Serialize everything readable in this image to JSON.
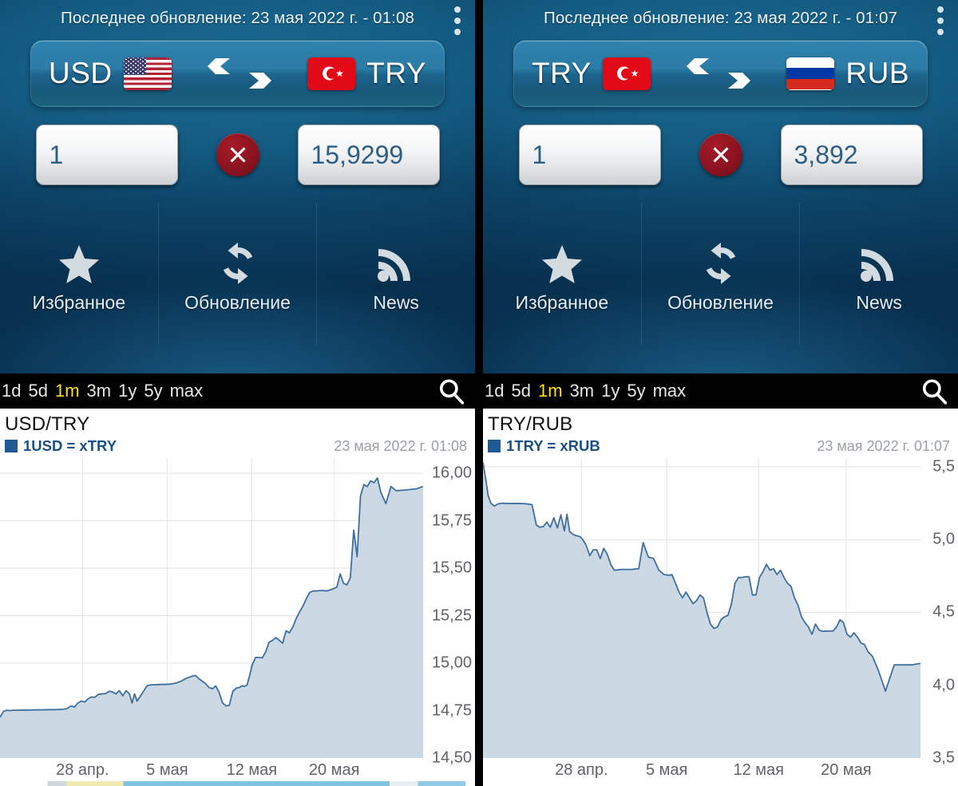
{
  "panels": [
    {
      "id": "usd-try",
      "last_update_label": "Последнее обновление: 23 мая 2022 г. - 01:08",
      "from_code": "USD",
      "from_flag": "flag-us-icon",
      "to_code": "TRY",
      "to_flag": "flag-tr-icon",
      "swap_icon": "swap-arrows-icon",
      "menu_icon": "overflow-menu-icon",
      "amount_value": "1",
      "amount_placeholder": "1",
      "multiply_icon": "clear-x-icon",
      "result_value": "15,9299",
      "actions": [
        {
          "icon": "star-icon",
          "label": "Избранное"
        },
        {
          "icon": "refresh-icon",
          "label": "Обновление"
        },
        {
          "icon": "rss-news-icon",
          "label": "News"
        }
      ],
      "ranges": [
        "1d",
        "5d",
        "1m",
        "3m",
        "1y",
        "5y",
        "max"
      ],
      "range_selected": "1m",
      "search_icon": "search-icon",
      "chart_title": "USD/TRY",
      "chart_legend": "1USD = xTRY",
      "chart_stamp": "23 мая 2022 г. 01:08",
      "legend_color": "#1f5a93"
    },
    {
      "id": "try-rub",
      "last_update_label": "Последнее обновление: 23 мая 2022 г. - 01:07",
      "from_code": "TRY",
      "from_flag": "flag-tr-icon",
      "to_code": "RUB",
      "to_flag": "flag-ru-icon",
      "swap_icon": "swap-arrows-icon",
      "menu_icon": "overflow-menu-icon",
      "amount_value": "1",
      "amount_placeholder": "1",
      "multiply_icon": "clear-x-icon",
      "result_value": "3,892",
      "actions": [
        {
          "icon": "star-icon",
          "label": "Избранное"
        },
        {
          "icon": "refresh-icon",
          "label": "Обновление"
        },
        {
          "icon": "rss-news-icon",
          "label": "News"
        }
      ],
      "ranges": [
        "1d",
        "5d",
        "1m",
        "3m",
        "1y",
        "5y",
        "max"
      ],
      "range_selected": "1m",
      "search_icon": "search-icon",
      "chart_title": "TRY/RUB",
      "chart_legend": "1TRY = xRUB",
      "chart_stamp": "23 мая 2022 г. 01:07",
      "legend_color": "#1f5a93"
    }
  ],
  "chart_data": [
    {
      "type": "area",
      "title": "USD/TRY",
      "legend": [
        "1USD = xTRY"
      ],
      "legend_position": "top-left",
      "xlabel": "",
      "ylabel": "",
      "grid": true,
      "ylim": [
        14.5,
        16.08
      ],
      "yticks": [
        16.0,
        15.75,
        15.5,
        15.25,
        15.0,
        14.75,
        14.5
      ],
      "ytick_labels": [
        "16,00",
        "15,75",
        "15,50",
        "15,25",
        "15,00",
        "14,75",
        "14,50"
      ],
      "xticks": [
        0.195,
        0.395,
        0.595,
        0.79
      ],
      "xtick_labels": [
        "28 апр.",
        "5 мая",
        "12 мая",
        "20 мая"
      ],
      "line_color": "#3f6f9e",
      "fill_color": "#ccd9e5",
      "x": [
        0.0,
        0.008,
        0.016,
        0.024,
        0.032,
        0.042,
        0.055,
        0.07,
        0.085,
        0.1,
        0.115,
        0.13,
        0.145,
        0.158,
        0.168,
        0.176,
        0.184,
        0.192,
        0.2,
        0.208,
        0.216,
        0.224,
        0.232,
        0.24,
        0.25,
        0.258,
        0.266,
        0.274,
        0.282,
        0.29,
        0.298,
        0.306,
        0.312,
        0.318,
        0.324,
        0.33,
        0.338,
        0.348,
        0.358,
        0.368,
        0.38,
        0.392,
        0.404,
        0.416,
        0.428,
        0.44,
        0.452,
        0.462,
        0.47,
        0.478,
        0.486,
        0.494,
        0.502,
        0.51,
        0.518,
        0.526,
        0.534,
        0.542,
        0.55,
        0.558,
        0.566,
        0.572,
        0.578,
        0.584,
        0.59,
        0.596,
        0.604,
        0.612,
        0.62,
        0.628,
        0.636,
        0.644,
        0.652,
        0.66,
        0.668,
        0.676,
        0.684,
        0.692,
        0.7,
        0.708,
        0.716,
        0.724,
        0.732,
        0.74,
        0.748,
        0.756,
        0.764,
        0.772,
        0.78,
        0.788,
        0.796,
        0.804,
        0.812,
        0.82,
        0.828,
        0.836,
        0.844,
        0.852,
        0.86,
        0.868,
        0.876,
        0.884,
        0.892,
        0.9,
        0.912,
        0.924,
        0.936,
        0.948,
        0.96,
        0.972,
        0.984,
        1.0
      ],
      "y": [
        14.715,
        14.745,
        14.752,
        14.75,
        14.752,
        14.752,
        14.753,
        14.753,
        14.754,
        14.754,
        14.755,
        14.755,
        14.756,
        14.76,
        14.775,
        14.768,
        14.79,
        14.8,
        14.795,
        14.812,
        14.822,
        14.82,
        14.835,
        14.838,
        14.84,
        14.852,
        14.848,
        14.838,
        14.855,
        14.828,
        14.855,
        14.838,
        14.79,
        14.838,
        14.8,
        14.82,
        14.848,
        14.882,
        14.886,
        14.886,
        14.888,
        14.888,
        14.89,
        14.895,
        14.905,
        14.92,
        14.93,
        14.935,
        14.918,
        14.905,
        14.892,
        14.872,
        14.865,
        14.88,
        14.845,
        14.79,
        14.775,
        14.778,
        14.85,
        14.868,
        14.872,
        14.88,
        14.878,
        14.885,
        14.935,
        14.99,
        15.03,
        15.03,
        15.028,
        15.06,
        15.11,
        15.12,
        15.135,
        15.12,
        15.105,
        15.17,
        15.16,
        15.19,
        15.235,
        15.27,
        15.3,
        15.34,
        15.372,
        15.38,
        15.38,
        15.382,
        15.382,
        15.38,
        15.385,
        15.392,
        15.4,
        15.47,
        15.42,
        15.412,
        15.45,
        15.7,
        15.56,
        15.88,
        15.94,
        15.93,
        15.96,
        15.95,
        15.975,
        15.9,
        15.84,
        15.93,
        15.908,
        15.91,
        15.912,
        15.915,
        15.918,
        15.93
      ]
    },
    {
      "type": "area",
      "title": "TRY/RUB",
      "legend": [
        "1TRY = xRUB"
      ],
      "legend_position": "top-left",
      "xlabel": "",
      "ylabel": "",
      "grid": true,
      "ylim": [
        3.5,
        5.56
      ],
      "yticks": [
        5.5,
        5.0,
        4.5,
        4.0,
        3.5
      ],
      "ytick_labels": [
        "5,5",
        "5,0",
        "4,5",
        "4,0",
        "3,5"
      ],
      "xticks": [
        0.225,
        0.42,
        0.63,
        0.83
      ],
      "xtick_labels": [
        "28 апр.",
        "5 мая",
        "12 мая",
        "20 мая"
      ],
      "line_color": "#3f6f9e",
      "fill_color": "#ccd9e5",
      "x": [
        0.0,
        0.006,
        0.012,
        0.018,
        0.026,
        0.034,
        0.044,
        0.056,
        0.07,
        0.084,
        0.098,
        0.112,
        0.122,
        0.13,
        0.138,
        0.146,
        0.154,
        0.162,
        0.17,
        0.178,
        0.186,
        0.192,
        0.198,
        0.204,
        0.21,
        0.216,
        0.222,
        0.228,
        0.236,
        0.244,
        0.252,
        0.26,
        0.268,
        0.276,
        0.284,
        0.292,
        0.3,
        0.308,
        0.316,
        0.324,
        0.332,
        0.34,
        0.348,
        0.356,
        0.366,
        0.378,
        0.39,
        0.402,
        0.414,
        0.424,
        0.432,
        0.44,
        0.448,
        0.456,
        0.464,
        0.472,
        0.48,
        0.488,
        0.496,
        0.504,
        0.512,
        0.52,
        0.528,
        0.536,
        0.544,
        0.552,
        0.56,
        0.568,
        0.576,
        0.584,
        0.592,
        0.6,
        0.608,
        0.616,
        0.624,
        0.632,
        0.64,
        0.648,
        0.656,
        0.664,
        0.672,
        0.68,
        0.688,
        0.696,
        0.704,
        0.712,
        0.72,
        0.728,
        0.736,
        0.744,
        0.752,
        0.76,
        0.768,
        0.776,
        0.784,
        0.792,
        0.8,
        0.808,
        0.816,
        0.824,
        0.832,
        0.84,
        0.848,
        0.856,
        0.864,
        0.872,
        0.88,
        0.89,
        0.904,
        0.92,
        0.94,
        0.96,
        0.98,
        1.0
      ],
      "y": [
        5.53,
        5.42,
        5.3,
        5.25,
        5.23,
        5.245,
        5.25,
        5.248,
        5.248,
        5.248,
        5.246,
        5.24,
        5.1,
        5.085,
        5.09,
        5.12,
        5.085,
        5.15,
        5.08,
        5.17,
        5.06,
        5.175,
        5.055,
        5.04,
        5.03,
        5.025,
        5.02,
        5.0,
        4.96,
        4.89,
        4.93,
        4.93,
        4.87,
        4.94,
        4.9,
        4.83,
        4.79,
        4.792,
        4.795,
        4.795,
        4.795,
        4.795,
        4.798,
        4.8,
        4.98,
        4.88,
        4.87,
        4.79,
        4.76,
        4.755,
        4.76,
        4.7,
        4.64,
        4.6,
        4.64,
        4.6,
        4.56,
        4.58,
        4.62,
        4.6,
        4.5,
        4.42,
        4.39,
        4.4,
        4.45,
        4.47,
        4.48,
        4.56,
        4.7,
        4.74,
        4.74,
        4.745,
        4.745,
        4.62,
        4.62,
        4.74,
        4.78,
        4.83,
        4.79,
        4.8,
        4.76,
        4.79,
        4.74,
        4.7,
        4.68,
        4.6,
        4.55,
        4.47,
        4.43,
        4.4,
        4.35,
        4.42,
        4.38,
        4.37,
        4.372,
        4.372,
        4.372,
        4.4,
        4.45,
        4.43,
        4.35,
        4.33,
        4.36,
        4.33,
        4.29,
        4.28,
        4.23,
        4.2,
        4.1,
        3.96,
        4.14,
        4.14,
        4.14,
        4.15
      ]
    }
  ]
}
